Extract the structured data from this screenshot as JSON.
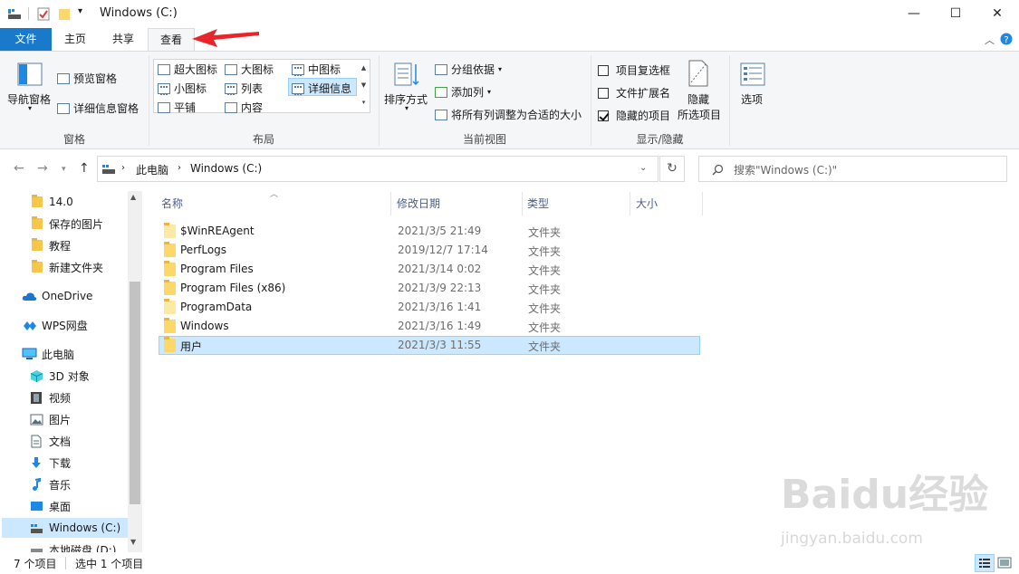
{
  "window": {
    "title": "Windows (C:)",
    "min": "—",
    "max": "☐",
    "close": "✕"
  },
  "tabs": {
    "file": "文件",
    "home": "主页",
    "share": "共享",
    "view": "查看"
  },
  "ribbon": {
    "pane": {
      "nav_pane": "导航窗格",
      "preview": "预览窗格",
      "details": "详细信息窗格",
      "label": "窗格"
    },
    "layout": {
      "extra_large": "超大图标",
      "large": "大图标",
      "medium": "中图标",
      "small": "小图标",
      "list": "列表",
      "details": "详细信息",
      "tiles": "平铺",
      "content": "内容",
      "label": "布局"
    },
    "current_view": {
      "sort": "排序方式",
      "group": "分组依据",
      "add_col": "添加列",
      "fit_cols": "将所有列调整为合适的大小",
      "label": "当前视图"
    },
    "show_hide": {
      "checkboxes": "项目复选框",
      "extensions": "文件扩展名",
      "hidden": "隐藏的项目",
      "hide_selected_1": "隐藏",
      "hide_selected_2": "所选项目",
      "label": "显示/隐藏"
    },
    "options": "选项"
  },
  "address": {
    "crumb1": "此电脑",
    "crumb2": "Windows (C:)",
    "search_placeholder": "搜索\"Windows (C:)\""
  },
  "nav": {
    "items": [
      "14.0",
      "保存的图片",
      "教程",
      "新建文件夹",
      "OneDrive",
      "WPS网盘",
      "此电脑",
      "3D 对象",
      "视频",
      "图片",
      "文档",
      "下载",
      "音乐",
      "桌面",
      "Windows (C:)",
      "本地磁盘 (D:)"
    ]
  },
  "columns": {
    "name": "名称",
    "date": "修改日期",
    "type": "类型",
    "size": "大小"
  },
  "files": [
    {
      "name": "$WinREAgent",
      "date": "2021/3/5 21:49",
      "type": "文件夹"
    },
    {
      "name": "PerfLogs",
      "date": "2019/12/7 17:14",
      "type": "文件夹"
    },
    {
      "name": "Program Files",
      "date": "2021/3/14 0:02",
      "type": "文件夹"
    },
    {
      "name": "Program Files (x86)",
      "date": "2021/3/9 22:13",
      "type": "文件夹"
    },
    {
      "name": "ProgramData",
      "date": "2021/3/16 1:41",
      "type": "文件夹"
    },
    {
      "name": "Windows",
      "date": "2021/3/16 1:49",
      "type": "文件夹"
    },
    {
      "name": "用户",
      "date": "2021/3/3 11:55",
      "type": "文件夹"
    }
  ],
  "status": {
    "count": "7 个项目",
    "selected": "选中 1 个项目"
  },
  "watermark": {
    "brand": "Baidu经验",
    "url": "jingyan.baidu.com"
  },
  "colors": {
    "accent": "#1979ca",
    "selection": "#cce8ff",
    "arrow": "#e8262a"
  }
}
